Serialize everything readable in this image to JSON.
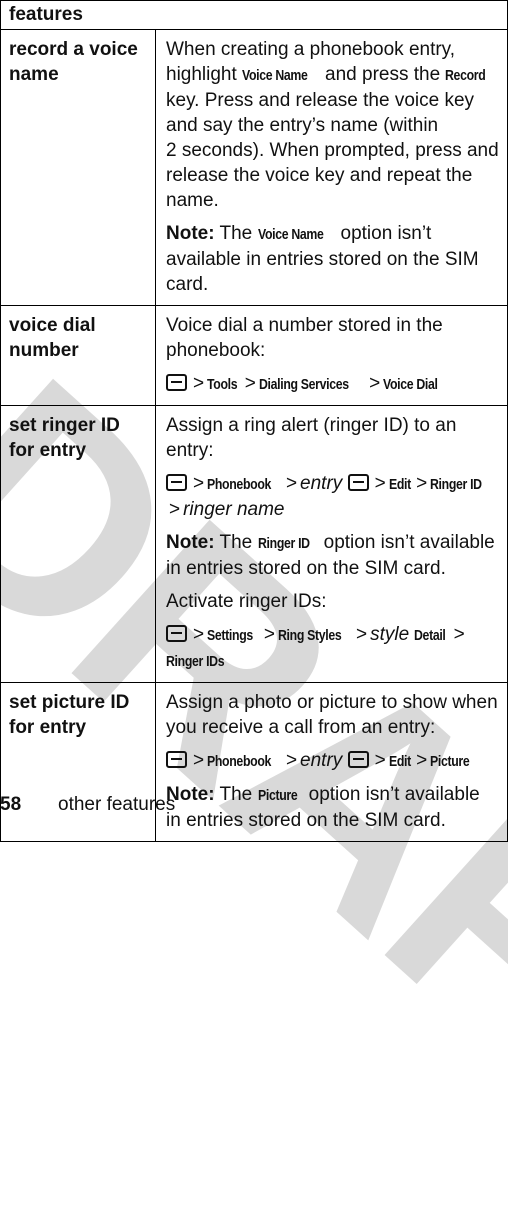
{
  "watermark": "DRAFT",
  "table": {
    "header": "features",
    "rows": [
      {
        "name": "record a voice name",
        "paragraphs": [
          {
            "parts": [
              {
                "t": "When creating a phonebook entry, highlight "
              },
              {
                "ui": "Voice Name"
              },
              {
                "t": " and press the "
              },
              {
                "ui": "Record"
              },
              {
                "t": " key. Press and release the voice key and say the entry’s name (within 2 seconds). When prompted, press and release the voice key and repeat the name."
              }
            ]
          },
          {
            "parts": [
              {
                "note": "Note:"
              },
              {
                "t": " The "
              },
              {
                "ui": "Voice Name"
              },
              {
                "t": " option isn’t available in entries stored on the SIM card."
              }
            ]
          }
        ]
      },
      {
        "name": "voice dial number",
        "paragraphs": [
          {
            "parts": [
              {
                "t": "Voice dial a number stored in the phonebook:"
              }
            ]
          },
          {
            "parts": [
              {
                "icon": "menu-key-icon"
              },
              {
                "gt": ">"
              },
              {
                "ui": "Tools"
              },
              {
                "gt": ">"
              },
              {
                "ui": "Dialing Services"
              },
              {
                "gt": ">"
              },
              {
                "ui": "Voice Dial"
              }
            ]
          }
        ]
      },
      {
        "name": "set ringer ID for entry",
        "paragraphs": [
          {
            "parts": [
              {
                "t": "Assign a ring alert (ringer ID) to an entry:"
              }
            ]
          },
          {
            "parts": [
              {
                "icon": "menu-key-icon"
              },
              {
                "gt": ">"
              },
              {
                "ui": "Phonebook"
              },
              {
                "gt": ">"
              },
              {
                "it": "entry "
              },
              {
                "icon": "menu-key-icon"
              },
              {
                "gt": ">"
              },
              {
                "ui": "Edit"
              },
              {
                "gt": ">"
              },
              {
                "ui": "Ringer ID"
              },
              {
                "gt": ">"
              },
              {
                "it": "ringer name"
              }
            ]
          },
          {
            "parts": [
              {
                "note": "Note:"
              },
              {
                "t": " The "
              },
              {
                "ui": "Ringer ID"
              },
              {
                "t": " option isn’t available in entries stored on the SIM card."
              }
            ]
          },
          {
            "parts": [
              {
                "t": "Activate ringer IDs:"
              }
            ]
          },
          {
            "parts": [
              {
                "icon": "menu-key-icon"
              },
              {
                "gt": ">"
              },
              {
                "ui": "Settings"
              },
              {
                "gt": ">"
              },
              {
                "ui": "Ring Styles"
              },
              {
                "gt": ">"
              },
              {
                "it": "style "
              },
              {
                "ui": "Detail"
              },
              {
                "gt": ">"
              },
              {
                "ui": "Ringer IDs"
              }
            ]
          }
        ]
      },
      {
        "name": "set picture ID for entry",
        "paragraphs": [
          {
            "parts": [
              {
                "t": "Assign a photo or picture to show when you receive a call from an entry:"
              }
            ]
          },
          {
            "parts": [
              {
                "icon": "menu-key-icon"
              },
              {
                "gt": ">"
              },
              {
                "ui": "Phonebook"
              },
              {
                "gt": ">"
              },
              {
                "it": "entry "
              },
              {
                "icon": "menu-key-icon"
              },
              {
                "gt": ">"
              },
              {
                "ui": "Edit"
              },
              {
                "gt": ">"
              },
              {
                "ui": "Picture"
              }
            ]
          },
          {
            "parts": [
              {
                "note": "Note:"
              },
              {
                "t": " The "
              },
              {
                "ui": "Picture"
              },
              {
                "t": " option isn’t available in entries stored on the SIM card."
              }
            ]
          }
        ]
      }
    ]
  },
  "footer": {
    "page_number": "58",
    "section": "other features"
  }
}
